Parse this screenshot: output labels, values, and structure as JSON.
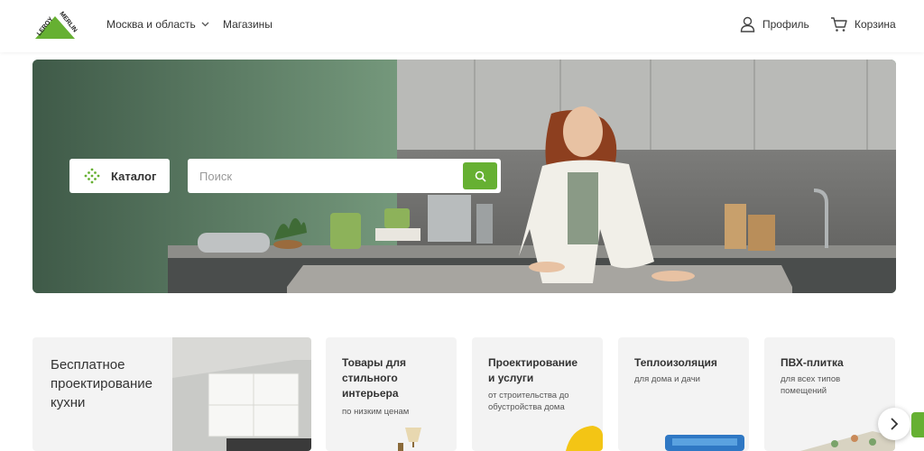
{
  "header": {
    "logo_text_top": "MERLIN",
    "logo_text_side": "LEROY",
    "region_label": "Москва и область",
    "stores_label": "Магазины",
    "profile_label": "Профиль",
    "cart_label": "Корзина"
  },
  "hero": {
    "catalog_label": "Каталог",
    "search_placeholder": "Поиск"
  },
  "cards": [
    {
      "title_lines": [
        "Бесплатное",
        "проектирование",
        "кухни"
      ]
    },
    {
      "title_lines": [
        "Товары для",
        "стильного",
        "интерьера"
      ],
      "subtitle_lines": [
        "по низким ценам"
      ]
    },
    {
      "title_lines": [
        "Проектирование",
        "и услуги"
      ],
      "subtitle_lines": [
        "от строительства до",
        "обустройства дома"
      ]
    },
    {
      "title_lines": [
        "Теплоизоляция"
      ],
      "subtitle_lines": [
        "для дома и дачи"
      ]
    },
    {
      "title_lines": [
        "ПВХ-плитка"
      ],
      "subtitle_lines": [
        "для всех типов",
        "помещений"
      ]
    }
  ],
  "colors": {
    "brand_green": "#66b032",
    "card_bg": "#f3f3f3"
  },
  "icons": {
    "profile": "user-icon",
    "cart": "cart-icon",
    "search": "search-icon",
    "catalog": "catalog-dots-icon",
    "region_chevron": "chevron-down-icon",
    "next": "chevron-right-icon"
  }
}
